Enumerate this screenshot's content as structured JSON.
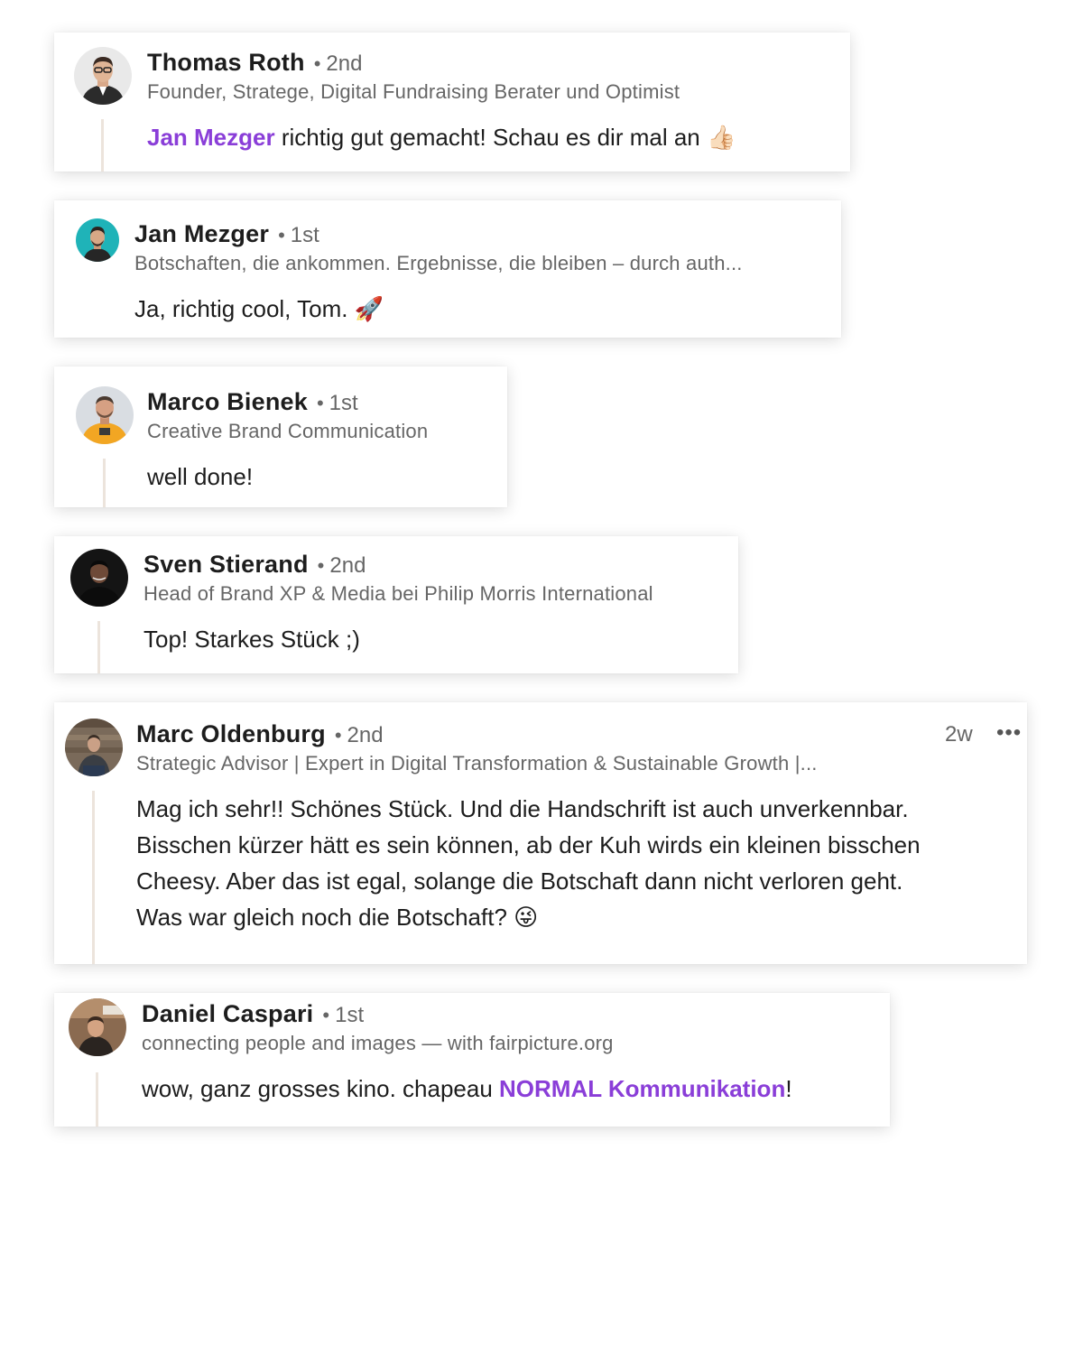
{
  "comments": [
    {
      "author": "Thomas Roth",
      "degree": "2nd",
      "headline": "Founder, Stratege, Digital Fundraising Berater und Optimist",
      "mention": "Jan Mezger",
      "text": " richtig gut gemacht! Schau es dir mal an ",
      "emoji": "👍🏻"
    },
    {
      "author": "Jan Mezger",
      "degree": "1st",
      "headline": "Botschaften, die ankommen. Ergebnisse, die bleiben – durch auth...",
      "text": "Ja, richtig cool, Tom. ",
      "emoji": "🚀"
    },
    {
      "author": "Marco Bienek",
      "degree": "1st",
      "headline": "Creative Brand Communication",
      "text": "well done!"
    },
    {
      "author": "Sven Stierand",
      "degree": "2nd",
      "headline": "Head of Brand XP & Media bei Philip Morris International",
      "text": "Top! Starkes Stück ;)"
    },
    {
      "author": "Marc Oldenburg",
      "degree": "2nd",
      "timestamp": "2w",
      "more_icon": "•••",
      "headline": "Strategic Advisor | Expert in Digital Transformation & Sustainable Growth |...",
      "text_lines": [
        "Mag ich sehr!! Schönes Stück. Und die Handschrift ist auch unverkennbar.",
        "Bisschen kürzer hätt es sein können, ab der Kuh wirds ein kleinen bisschen",
        "Cheesy. Aber das ist egal, solange die Botschaft dann nicht verloren geht.",
        "Was war gleich noch die Botschaft? "
      ],
      "emoji": "😜"
    },
    {
      "author": "Daniel Caspari",
      "degree": "1st",
      "headline": "connecting people and images — with fairpicture.org",
      "text": "wow, ganz grosses kino. chapeau ",
      "mention": "NORMAL Kommunikation",
      "text_end": "!"
    }
  ],
  "separator": "•",
  "colors": {
    "mention": "#8a3ed8",
    "thread_line": "#ece4dc",
    "secondary_text": "#666666"
  }
}
